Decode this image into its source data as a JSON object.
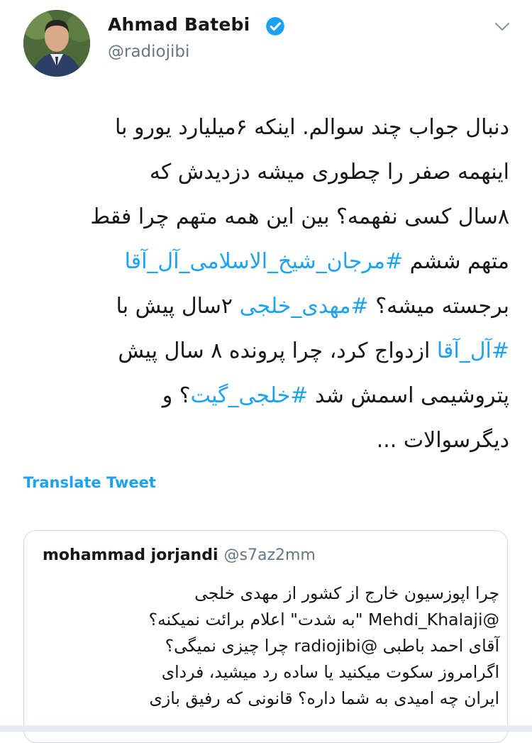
{
  "author": {
    "name": "Ahmad Batebi",
    "handle": "@radiojibi",
    "verified": true,
    "avatar_icon": "profile-photo"
  },
  "tweet": {
    "lines": [
      [
        {
          "t": "دنبال جواب چند سوالم. اینکه ۶میلیارد یورو با",
          "tag": false
        }
      ],
      [
        {
          "t": "اینهمه صفر را چطوری میشه دزدیدش که",
          "tag": false
        }
      ],
      [
        {
          "t": "۸سال کسی نفهمه؟ بین این همه متهم چرا فقط",
          "tag": false
        }
      ],
      [
        {
          "t": "متهم ششم ",
          "tag": false
        },
        {
          "t": "#مرجان_شیخ_الاسلامی_آل_آقا",
          "tag": true
        }
      ],
      [
        {
          "t": "برجسته میشه؟ ",
          "tag": false
        },
        {
          "t": "#مهدی_خلجی",
          "tag": true
        },
        {
          "t": " ۲سال پیش با",
          "tag": false
        }
      ],
      [
        {
          "t": "#آل_آقا",
          "tag": true
        },
        {
          "t": " ازدواج کرد، چرا پرونده ۸ سال پیش",
          "tag": false
        }
      ],
      [
        {
          "t": "پتروشیمی اسمش شد ",
          "tag": false
        },
        {
          "t": "#خلجی_گیت",
          "tag": true
        },
        {
          "t": "؟ و",
          "tag": false
        }
      ],
      [
        {
          "t": "دیگرسوالات ...",
          "tag": false
        }
      ]
    ]
  },
  "translate_label": "Translate Tweet",
  "quote": {
    "name": "mohammad jorjandi",
    "handle": "@s7az2mm",
    "lines": [
      "چرا اپوزسیون خارج از کشور از مهدی خلجی",
      "@Mehdi_Khalaji \"به شدت\" اعلام برائت نمیکنه؟",
      "آقای احمد باطبی @radiojibi چرا چیزی نمیگی؟",
      "اگرامروز سکوت میکنید یا ساده رد میشید، فردای",
      "ایران چه امیدی به شما داره؟ قانونی که رفیق بازی"
    ]
  },
  "colors": {
    "link": "#1da1f2",
    "muted": "#657786",
    "border": "#ccd6dd"
  }
}
